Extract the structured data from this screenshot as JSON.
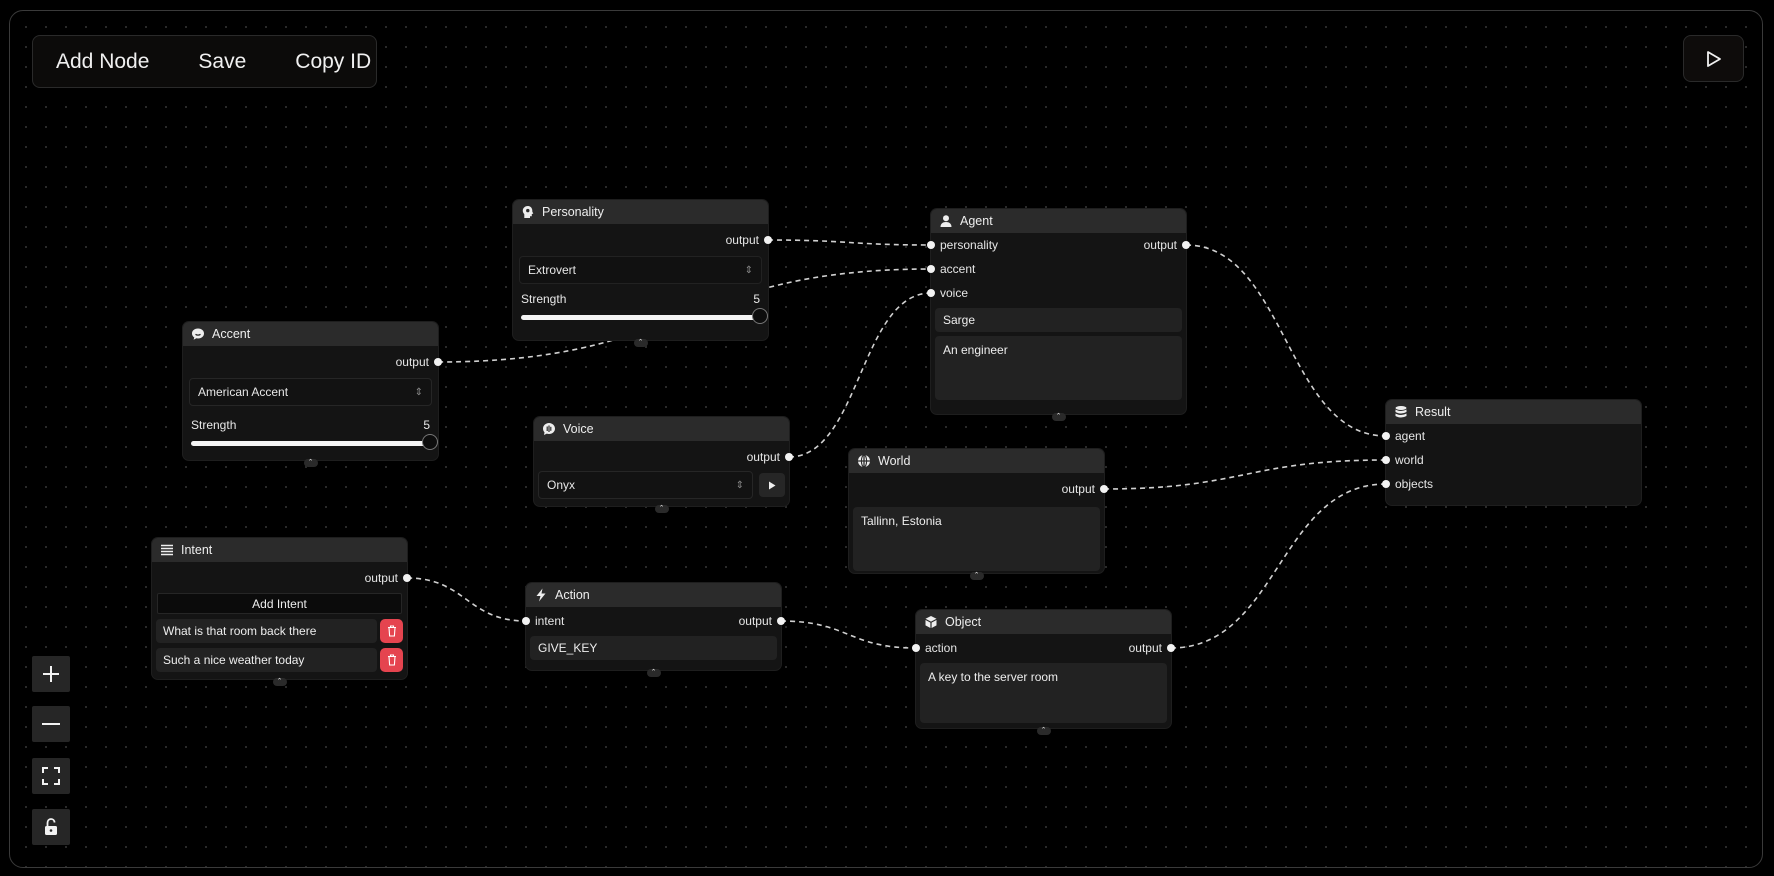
{
  "toolbar": {
    "add_node": "Add Node",
    "save": "Save",
    "copy_id": "Copy ID"
  },
  "run_button": {
    "icon": "play-icon"
  },
  "controls": [
    {
      "name": "zoom-in",
      "icon": "plus-icon"
    },
    {
      "name": "zoom-out",
      "icon": "minus-icon"
    },
    {
      "name": "fit-view",
      "icon": "fullscreen-icon"
    },
    {
      "name": "toggle-lock",
      "icon": "unlock-icon"
    }
  ],
  "colors": {
    "background": "#000000",
    "node_body": "#141414",
    "node_header": "#2b2b2b",
    "edge": "#d0d0d0",
    "delete": "#e5444f"
  },
  "nodes": {
    "personality": {
      "title": "Personality",
      "icon": "head-icon",
      "output": "output",
      "select": "Extrovert",
      "strength_label": "Strength",
      "strength_value": "5",
      "strength_fraction": 1.0
    },
    "accent": {
      "title": "Accent",
      "icon": "speech-bubble-icon",
      "output": "output",
      "select": "American Accent",
      "strength_label": "Strength",
      "strength_value": "5",
      "strength_fraction": 1.0
    },
    "voice": {
      "title": "Voice",
      "icon": "voice-bubble-icon",
      "output": "output",
      "select": "Onyx"
    },
    "agent": {
      "title": "Agent",
      "icon": "user-icon",
      "inputs": [
        "personality",
        "accent",
        "voice"
      ],
      "output": "output",
      "name": "Sarge",
      "description": "An engineer"
    },
    "world": {
      "title": "World",
      "icon": "globe-icon",
      "output": "output",
      "text": "Tallinn, Estonia"
    },
    "result": {
      "title": "Result",
      "icon": "database-icon",
      "inputs": [
        "agent",
        "world",
        "objects"
      ]
    },
    "intent": {
      "title": "Intent",
      "icon": "list-icon",
      "output": "output",
      "add_label": "Add Intent",
      "items": [
        "What is that room back there",
        "Such a nice weather today"
      ]
    },
    "action": {
      "title": "Action",
      "icon": "bolt-icon",
      "input": "intent",
      "output": "output",
      "value": "GIVE_KEY"
    },
    "object": {
      "title": "Object",
      "icon": "cube-icon",
      "input": "action",
      "output": "output",
      "text": "A key to the server room"
    }
  },
  "edges": [
    {
      "from": "personality.output",
      "to": "agent.personality"
    },
    {
      "from": "accent.output",
      "to": "agent.accent"
    },
    {
      "from": "voice.output",
      "to": "agent.voice"
    },
    {
      "from": "agent.output",
      "to": "result.agent"
    },
    {
      "from": "world.output",
      "to": "result.world"
    },
    {
      "from": "intent.output",
      "to": "action.intent"
    },
    {
      "from": "action.output",
      "to": "object.action"
    },
    {
      "from": "object.output",
      "to": "result.objects"
    }
  ]
}
